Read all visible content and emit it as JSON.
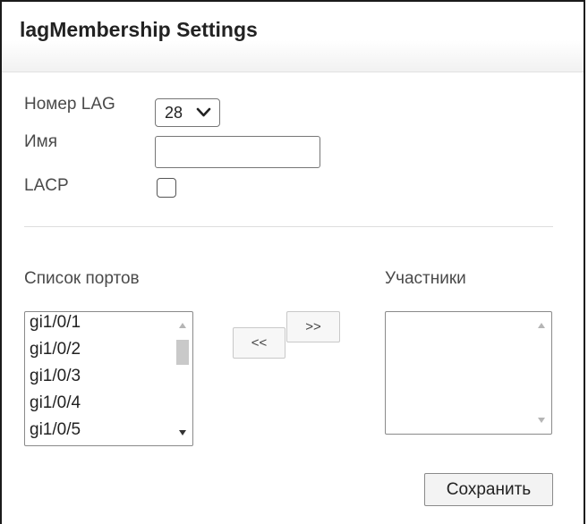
{
  "title": "lagMembership Settings",
  "form": {
    "lag_number_label": "Номер LAG",
    "lag_number_value": "28",
    "name_label": "Имя",
    "name_value": "",
    "lacp_label": "LACP",
    "lacp_checked": false
  },
  "ports_list": {
    "label": "Список портов",
    "items": [
      "gi1/0/1",
      "gi1/0/2",
      "gi1/0/3",
      "gi1/0/4",
      "gi1/0/5"
    ]
  },
  "members_list": {
    "label": "Участники",
    "items": []
  },
  "buttons": {
    "add": ">>",
    "remove": "<<",
    "save": "Сохранить"
  },
  "colors": {
    "text": "#333333",
    "border": "#767676",
    "scroll_thumb": "#c9c9c9"
  },
  "icons": {
    "select_arrow": "chevron-down-icon",
    "scroll_up": "triangle-up-icon",
    "scroll_down": "triangle-down-icon"
  }
}
